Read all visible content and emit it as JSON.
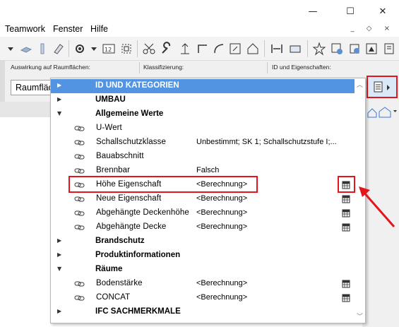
{
  "window": {
    "minimize": "—",
    "maximize": "☐",
    "close": "✕"
  },
  "menu": {
    "items": [
      "Teamwork",
      "Fenster",
      "Hilfe"
    ],
    "mdi": "_ ◇ ×"
  },
  "info": {
    "labels": [
      "Auswirkung auf Raumflächen:",
      "Klassifizierung:",
      "ID und Eigenschaften:"
    ],
    "raum_field_value": "Raumfläc"
  },
  "panel": {
    "rows": [
      {
        "type": "group",
        "arrow": "▶",
        "label": "ID UND KATEGORIEN",
        "selected": true
      },
      {
        "type": "group",
        "arrow": "▶",
        "label": "UMBAU"
      },
      {
        "type": "group",
        "arrow": "▼",
        "label": "Allgemeine Werte"
      },
      {
        "type": "prop",
        "label": "U-Wert",
        "value": "",
        "calc": false
      },
      {
        "type": "prop",
        "label": "Schallschutzklasse",
        "value": "Unbestimmt; SK 1; Schallschutzstufe I;...",
        "calc": false
      },
      {
        "type": "prop",
        "label": "Bauabschnitt",
        "value": "",
        "calc": false
      },
      {
        "type": "prop",
        "label": "Brennbar",
        "value": "Falsch",
        "calc": false
      },
      {
        "type": "prop",
        "label": "Höhe Eigenschaft",
        "value": "<Berechnung>",
        "calc": true
      },
      {
        "type": "prop",
        "label": "Neue Eigenschaft",
        "value": "<Berechnung>",
        "calc": true
      },
      {
        "type": "prop",
        "label": "Abgehängte Deckenhöhe",
        "value": "<Berechnung>",
        "calc": true
      },
      {
        "type": "prop",
        "label": "Abgehängte Decke",
        "value": "<Berechnung>",
        "calc": true
      },
      {
        "type": "group",
        "arrow": "▶",
        "label": "Brandschutz"
      },
      {
        "type": "group",
        "arrow": "▶",
        "label": "Produktinformationen"
      },
      {
        "type": "group",
        "arrow": "▼",
        "label": "Räume"
      },
      {
        "type": "prop",
        "label": "Bodenstärke",
        "value": "<Berechnung>",
        "calc": true
      },
      {
        "type": "prop",
        "label": "CONCAT",
        "value": "<Berechnung>",
        "calc": true
      },
      {
        "type": "group",
        "arrow": "▶",
        "label": "IFC SACHMERKMALE"
      }
    ]
  },
  "colors": {
    "selection": "#5294e2",
    "annotation": "#e3161d"
  },
  "icons": [
    "property-link-icon",
    "calculator-icon",
    "document-icon",
    "arrow-annotation"
  ]
}
